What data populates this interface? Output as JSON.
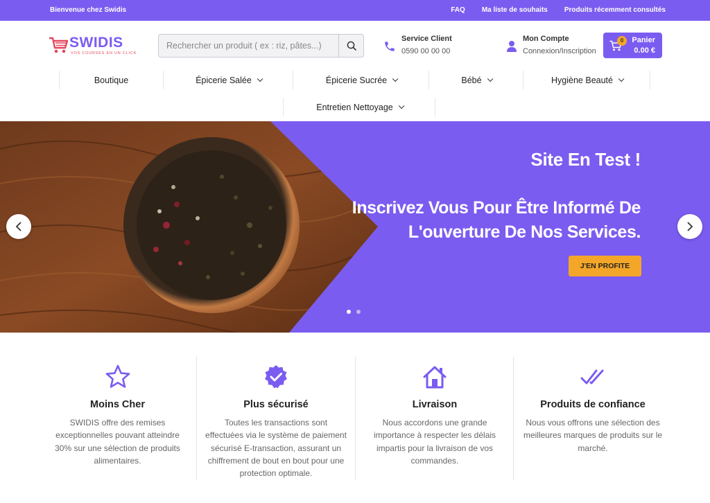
{
  "topbar": {
    "welcome": "Bienvenue chez Swidis",
    "links": [
      "FAQ",
      "Ma liste de souhaits",
      "Produits récemment consultés"
    ]
  },
  "header": {
    "logo": {
      "brand": "SWIDIS",
      "tagline": "VOS COURSES EN UN CLICK"
    },
    "search": {
      "placeholder": "Rechercher un produit ( ex : riz, pâtes...)"
    },
    "service": {
      "title": "Service Client",
      "phone": "0590 00 00 00"
    },
    "account": {
      "title": "Mon Compte",
      "subtitle": "Connexion/Inscription"
    },
    "cart": {
      "count": "0",
      "label": "Panier",
      "total": "0.00 €"
    }
  },
  "nav": {
    "items": [
      {
        "label": "Boutique",
        "dropdown": false
      },
      {
        "label": "Épicerie Salée",
        "dropdown": true
      },
      {
        "label": "Épicerie Sucrée",
        "dropdown": true
      },
      {
        "label": "Bébé",
        "dropdown": true
      },
      {
        "label": "Hygiène Beauté",
        "dropdown": true
      },
      {
        "label": "Entretien Nettoyage",
        "dropdown": true
      }
    ]
  },
  "hero": {
    "title": "Site En Test !",
    "subtitle": "Inscrivez Vous Pour Être Informé De L'ouverture De Nos Services.",
    "cta": "J'EN PROFITE",
    "slides": 2,
    "active_slide": 1
  },
  "features": [
    {
      "icon": "star-icon",
      "title": "Moins Cher",
      "desc": "SWIDIS offre des remises exceptionnelles pouvant atteindre 30% sur une sélection de produits alimentaires."
    },
    {
      "icon": "verified-badge-icon",
      "title": "Plus sécurisé",
      "desc": "Toutes les transactions sont effectuées via le système de paiement sécurisé E-transaction, assurant un chiffrement de bout en bout pour une protection optimale."
    },
    {
      "icon": "house-icon",
      "title": "Livraison",
      "desc": "Nous accordons une grande importance à respecter les délais impartis pour la livraison de vos commandes."
    },
    {
      "icon": "double-check-icon",
      "title": "Produits de confiance",
      "desc": "Nous vous offrons une sélection des meilleures marques de produits sur le marché."
    }
  ],
  "colors": {
    "brand": "#7b5cf0",
    "accent": "#f3a627",
    "logo_red": "#e2475a"
  }
}
